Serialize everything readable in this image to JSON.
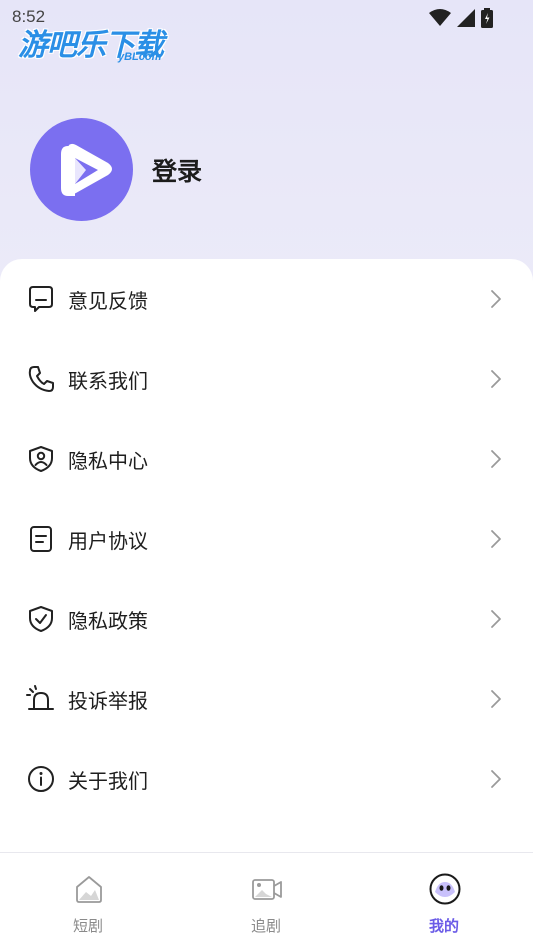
{
  "status_bar": {
    "time": "8:52"
  },
  "watermark": {
    "main": "游吧乐下载",
    "sub": "yBLcom"
  },
  "profile": {
    "login_label": "登录"
  },
  "menu": [
    {
      "label": "意见反馈",
      "icon": "feedback-icon"
    },
    {
      "label": "联系我们",
      "icon": "phone-icon"
    },
    {
      "label": "隐私中心",
      "icon": "privacy-shield-icon"
    },
    {
      "label": "用户协议",
      "icon": "document-icon"
    },
    {
      "label": "隐私政策",
      "icon": "shield-check-icon"
    },
    {
      "label": "投诉举报",
      "icon": "alarm-icon"
    },
    {
      "label": "关于我们",
      "icon": "info-icon"
    }
  ],
  "tabs": [
    {
      "label": "短剧",
      "icon": "home-icon",
      "active": false
    },
    {
      "label": "追剧",
      "icon": "video-icon",
      "active": false
    },
    {
      "label": "我的",
      "icon": "profile-face-icon",
      "active": true
    }
  ],
  "colors": {
    "accent": "#6b5ce7",
    "avatar": "#7b6ff0",
    "watermark": "#2a8fe6"
  }
}
